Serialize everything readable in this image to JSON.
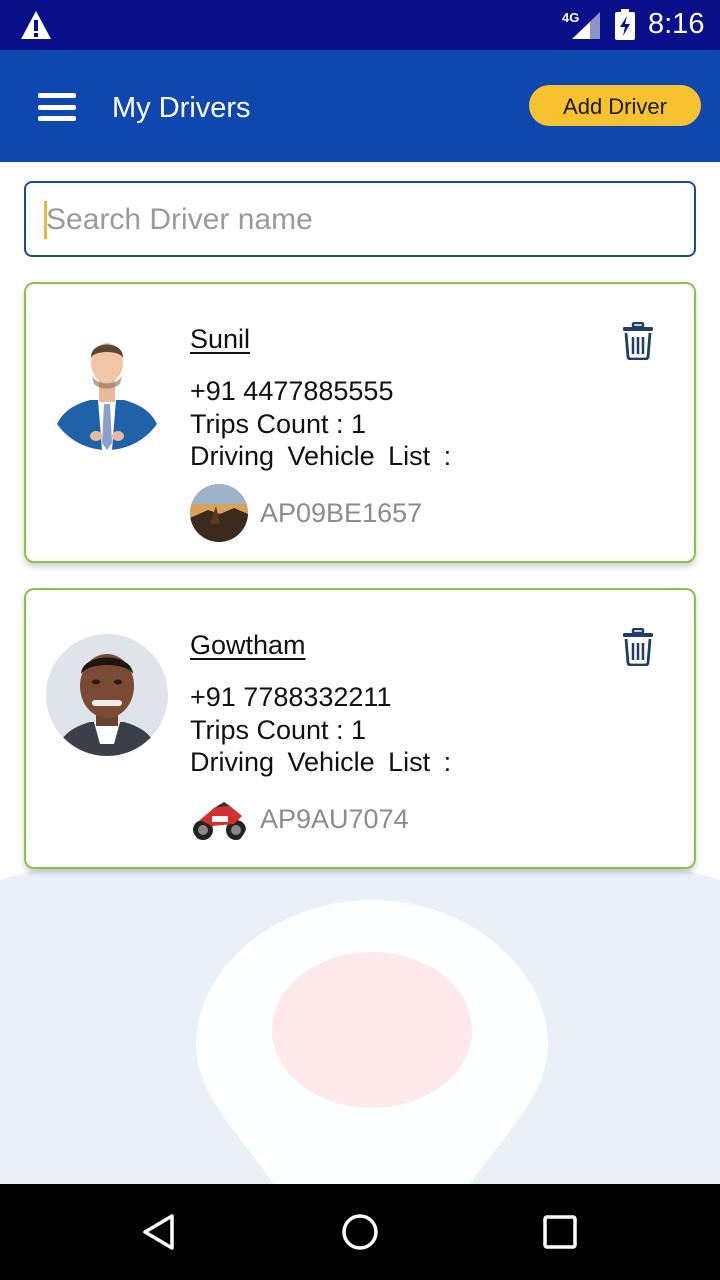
{
  "status_bar": {
    "network": "4G",
    "time": "8:16",
    "icons": [
      "warning-icon",
      "signal-icon",
      "battery-charging-icon"
    ]
  },
  "app_bar": {
    "title": "My Drivers",
    "add_driver_label": "Add Driver",
    "menu_icon": "menu-icon"
  },
  "search": {
    "placeholder": "Search Driver name",
    "value": ""
  },
  "drivers": [
    {
      "name": "Sunil ",
      "phone": "+91 4477885555",
      "trips": "Trips Count : 1",
      "vehicle_label": "Driving  Vehicle List :",
      "vehicles": [
        {
          "number": "AP09BE1657",
          "image": "landscape-thumbnail"
        }
      ],
      "avatar": "man-in-blue-suit"
    },
    {
      "name": "Gowtham",
      "phone": "+91 7788332211",
      "trips": "Trips Count : 1",
      "vehicle_label": "Driving  Vehicle List :",
      "vehicles": [
        {
          "number": "AP9AU7074",
          "image": "motorcycle-thumbnail"
        }
      ],
      "avatar": "man-portrait"
    }
  ],
  "colors": {
    "status_bar": "#0a0f8a",
    "app_bar": "#0e47b0",
    "accent_button": "#f7c22f",
    "card_border": "#8bc34a",
    "search_border": "#1d4a8c",
    "delete_icon": "#1f3d66"
  },
  "nav_bar": {
    "icons": [
      "back-icon",
      "home-icon",
      "recent-apps-icon"
    ]
  }
}
